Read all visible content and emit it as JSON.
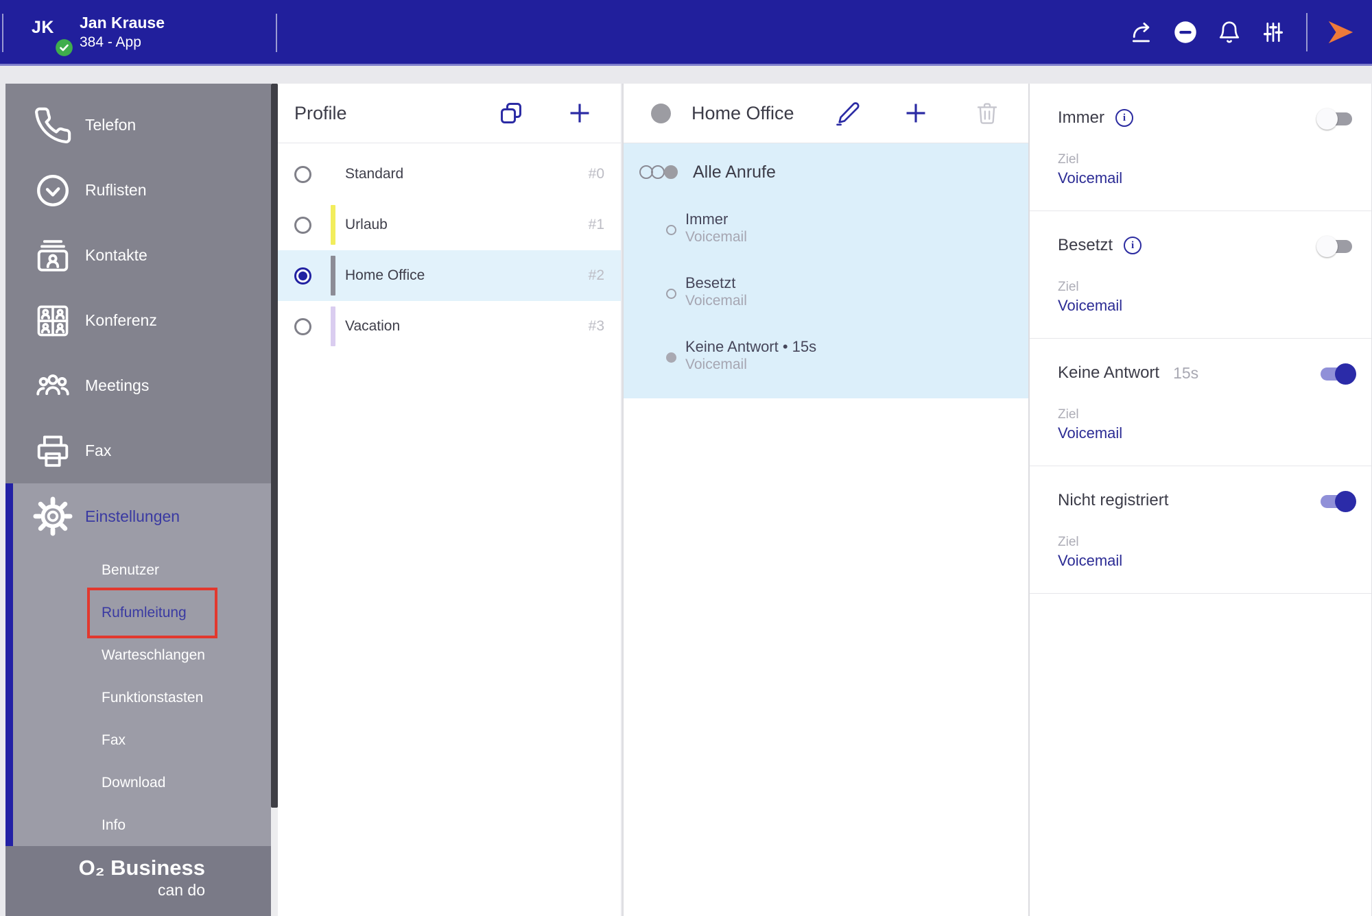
{
  "topbar": {
    "avatar_initials": "JK",
    "user_name": "Jan Krause",
    "user_line": "384 - App",
    "icons": [
      {
        "name": "call-forwarding-icon"
      },
      {
        "name": "do-not-disturb-icon"
      },
      {
        "name": "notifications-bell-icon"
      },
      {
        "name": "filter-sliders-icon"
      },
      {
        "name": "logout-arrow-icon"
      }
    ]
  },
  "sidebar": {
    "items": [
      {
        "label": "Telefon",
        "icon": "phone-icon"
      },
      {
        "label": "Ruflisten",
        "icon": "clock-icon"
      },
      {
        "label": "Kontakte",
        "icon": "contact-card-icon"
      },
      {
        "label": "Konferenz",
        "icon": "conference-grid-icon"
      },
      {
        "label": "Meetings",
        "icon": "people-icon"
      },
      {
        "label": "Fax",
        "icon": "printer-icon"
      }
    ],
    "settings": {
      "label": "Einstellungen",
      "icon": "gear-icon",
      "items": [
        {
          "label": "Benutzer",
          "active": false
        },
        {
          "label": "Rufumleitung",
          "active": true,
          "annotated": true
        },
        {
          "label": "Warteschlangen",
          "active": false
        },
        {
          "label": "Funktionstasten",
          "active": false
        },
        {
          "label": "Fax",
          "active": false
        },
        {
          "label": "Download",
          "active": false
        },
        {
          "label": "Info",
          "active": false
        }
      ]
    },
    "logo": {
      "brand": "O₂ Business",
      "tagline": "can do"
    }
  },
  "profiles": {
    "title": "Profile",
    "header_icons": [
      {
        "name": "copy-profile-icon"
      },
      {
        "name": "add-profile-icon"
      }
    ],
    "items": [
      {
        "name": "Standard",
        "number": "#0",
        "bar_color": "",
        "selected": false
      },
      {
        "name": "Urlaub",
        "number": "#1",
        "bar_color": "#F2ED5C",
        "selected": false
      },
      {
        "name": "Home Office",
        "number": "#2",
        "bar_color": "#8C8C96",
        "selected": true
      },
      {
        "name": "Vacation",
        "number": "#3",
        "bar_color": "#DACDF0",
        "selected": false
      }
    ]
  },
  "detail": {
    "title": "Home Office",
    "header_icons": [
      {
        "name": "edit-profile-icon"
      },
      {
        "name": "add-rule-icon"
      },
      {
        "name": "delete-profile-icon"
      }
    ],
    "all_calls_label": "Alle Anrufe",
    "rules": [
      {
        "name": "Immer",
        "target": "Voicemail",
        "filled": false
      },
      {
        "name": "Besetzt",
        "target": "Voicemail",
        "filled": false
      },
      {
        "name": "Keine Antwort • 15s",
        "target": "Voicemail",
        "filled": true
      }
    ]
  },
  "forwarding": {
    "sections": [
      {
        "title": "Immer",
        "suffix": "",
        "has_info": true,
        "enabled": false,
        "target_label": "Ziel",
        "target": "Voicemail"
      },
      {
        "title": "Besetzt",
        "suffix": "",
        "has_info": true,
        "enabled": false,
        "target_label": "Ziel",
        "target": "Voicemail"
      },
      {
        "title": "Keine Antwort",
        "suffix": "15s",
        "has_info": false,
        "enabled": true,
        "target_label": "Ziel",
        "target": "Voicemail"
      },
      {
        "title": "Nicht registriert",
        "suffix": "",
        "has_info": false,
        "enabled": true,
        "target_label": "Ziel",
        "target": "Voicemail"
      }
    ]
  },
  "colors": {
    "topbar_bg": "#211F9C",
    "accent_indigo": "#2B2BA4",
    "selected_row_bg": "#E2F2FB",
    "blue_card_bg": "#DCEFFA",
    "annotation_red": "#E2382E",
    "presence_green": "#3FAE4C",
    "logout_orange": "#EE7A3A",
    "toggle_on_track": "#9090D8",
    "toggle_on_knob": "#2B2BA8"
  }
}
